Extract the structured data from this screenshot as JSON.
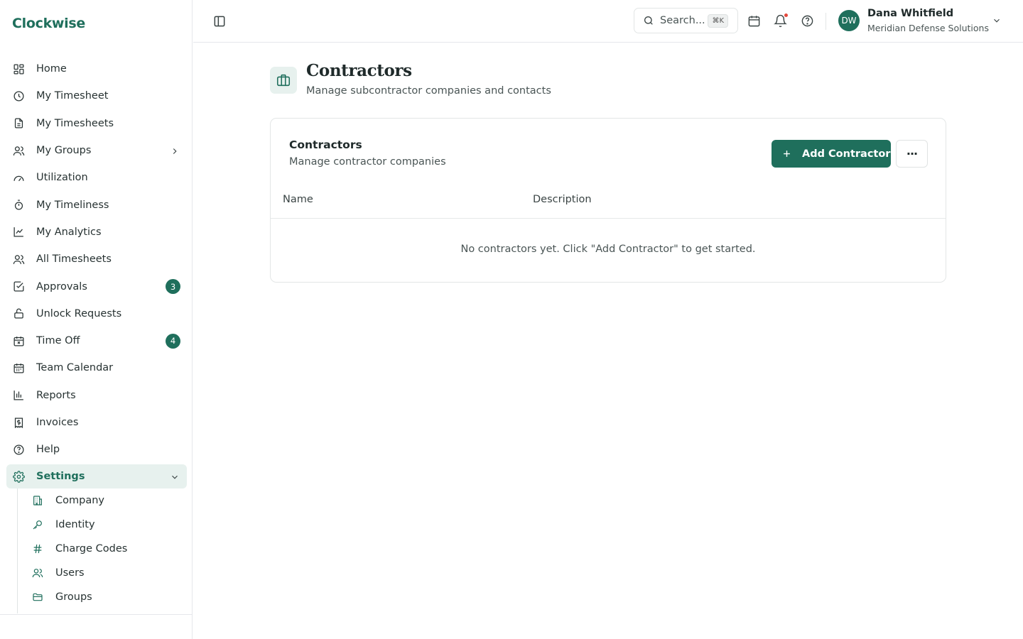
{
  "app": {
    "brand": "Clockwise"
  },
  "sidebar": {
    "items": [
      {
        "label": "Home",
        "icon": "grid-icon"
      },
      {
        "label": "My Timesheet",
        "icon": "clock-icon"
      },
      {
        "label": "My Timesheets",
        "icon": "document-icon"
      },
      {
        "label": "My Groups",
        "icon": "users-icon"
      },
      {
        "label": "Utilization",
        "icon": "gauge-icon"
      },
      {
        "label": "My Timeliness",
        "icon": "stopwatch-icon"
      },
      {
        "label": "My Analytics",
        "icon": "line-chart-icon"
      },
      {
        "label": "All Timesheets",
        "icon": "users-icon"
      },
      {
        "label": "Approvals",
        "icon": "check-square-icon",
        "badge": "3"
      },
      {
        "label": "Unlock Requests",
        "icon": "unlock-icon"
      },
      {
        "label": "Time Off",
        "icon": "calendar-x-icon",
        "badge": "4"
      },
      {
        "label": "Team Calendar",
        "icon": "calendar-icon"
      },
      {
        "label": "Reports",
        "icon": "bar-chart-icon"
      },
      {
        "label": "Invoices",
        "icon": "receipt-icon"
      },
      {
        "label": "Help",
        "icon": "help-icon"
      },
      {
        "label": "Settings",
        "icon": "gear-icon"
      }
    ],
    "settings_sub": [
      {
        "label": "Company",
        "icon": "building-icon"
      },
      {
        "label": "Identity",
        "icon": "key-icon"
      },
      {
        "label": "Charge Codes",
        "icon": "hash-icon"
      },
      {
        "label": "Users",
        "icon": "users-icon"
      },
      {
        "label": "Groups",
        "icon": "folder-icon"
      }
    ]
  },
  "header": {
    "search_placeholder": "Search...",
    "search_shortcut": "⌘K",
    "user": {
      "initials": "DW",
      "name": "Dana Whitfield",
      "org": "Meridian Defense Solutions"
    }
  },
  "page": {
    "title": "Contractors",
    "subtitle": "Manage subcontractor companies and contacts"
  },
  "card": {
    "title": "Contractors",
    "subtitle": "Manage contractor companies",
    "add_button": "Add Contractor",
    "more_label": "···",
    "columns": [
      "Name",
      "Description"
    ],
    "empty_message": "No contractors yet. Click \"Add Contractor\" to get started."
  },
  "colors": {
    "accent": "#1f6f5c",
    "accent_light": "#e7f1ee",
    "notification": "#e5483d"
  }
}
